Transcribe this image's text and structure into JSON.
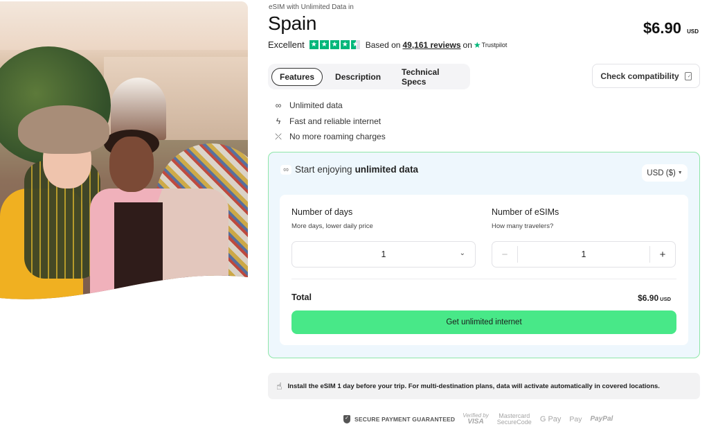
{
  "product": {
    "subtitle": "eSIM with Unlimited Data in",
    "title": "Spain",
    "price": "$6.90",
    "price_currency": "USD"
  },
  "rating": {
    "label": "Excellent",
    "stars": 4.5,
    "based_on": "Based on",
    "reviews": "49,161 reviews",
    "on": "on",
    "platform": "Trustpilot",
    "star_color": "#00b67a"
  },
  "tabs": [
    {
      "label": "Features",
      "active": true
    },
    {
      "label": "Description",
      "active": false
    },
    {
      "label": "Technical Specs",
      "active": false
    }
  ],
  "check_compatibility": {
    "label": "Check compatibility",
    "icon": "phone-check-icon"
  },
  "features": [
    {
      "icon": "infinity-icon",
      "glyph": "∞",
      "label": "Unlimited data"
    },
    {
      "icon": "lightning-icon",
      "glyph": "ϟ",
      "label": "Fast and reliable internet"
    },
    {
      "icon": "no-roaming-icon",
      "glyph": "⤫",
      "label": "No more roaming charges"
    }
  ],
  "plan": {
    "heading_prefix": "Start enjoying",
    "heading_bold": "unlimited data",
    "heading_icon_glyph": "∞",
    "currency_select": "USD ($)",
    "days": {
      "label": "Number of days",
      "hint": "More days, lower daily price",
      "value": "1"
    },
    "esims": {
      "label": "Number of eSIMs",
      "hint": "How many travelers?",
      "value": "1",
      "minus": "−",
      "plus": "+"
    },
    "total_label": "Total",
    "total_value": "$6.90",
    "total_currency": "USD",
    "cta_label": "Get unlimited internet",
    "cta_color": "#48e888",
    "border_color": "#8ee6a9",
    "background": "#eef7fd"
  },
  "notice": {
    "icon": "hand-tap-icon",
    "text": "Install the eSIM 1 day before your trip. For multi-destination plans, data will activate automatically in covered locations."
  },
  "payments": {
    "secure_label": "SECURE PAYMENT GUARANTEED",
    "visa": [
      "Verified by",
      "VISA"
    ],
    "mastercard": [
      "Mastercard",
      "SecureCode"
    ],
    "gpay": "G Pay",
    "apple_pay": " Pay",
    "paypal": "PayPal"
  }
}
